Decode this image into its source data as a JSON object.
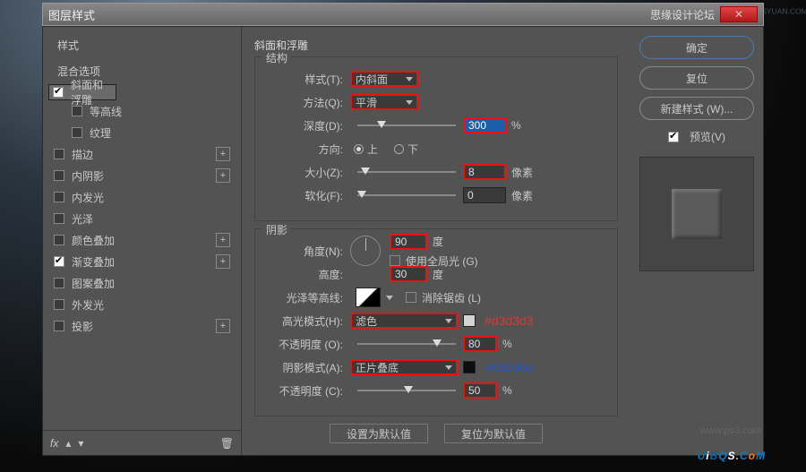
{
  "window": {
    "title": "图层样式",
    "brand": "思缘设计论坛",
    "watermark_url": "WWW.MISSYUAN.COM",
    "watermark2": "UiBQS.CoM",
    "ps3": "www.ps3.com"
  },
  "styles": {
    "header": "样式",
    "blending": "混合选项",
    "items": [
      {
        "label": "斜面和浮雕",
        "checked": true,
        "selected": true
      },
      {
        "label": "等高线",
        "checked": false,
        "indent": true
      },
      {
        "label": "纹理",
        "checked": false,
        "indent": true
      },
      {
        "label": "描边",
        "checked": false,
        "plus": true
      },
      {
        "label": "内阴影",
        "checked": false,
        "plus": true
      },
      {
        "label": "内发光",
        "checked": false
      },
      {
        "label": "光泽",
        "checked": false
      },
      {
        "label": "颜色叠加",
        "checked": false,
        "plus": true
      },
      {
        "label": "渐变叠加",
        "checked": true,
        "plus": true
      },
      {
        "label": "图案叠加",
        "checked": false
      },
      {
        "label": "外发光",
        "checked": false
      },
      {
        "label": "投影",
        "checked": false,
        "plus": true
      }
    ],
    "fx": "fx"
  },
  "bevel": {
    "title": "斜面和浮雕",
    "structure_legend": "结构",
    "style_label": "样式(T):",
    "style_value": "内斜面",
    "technique_label": "方法(Q):",
    "technique_value": "平滑",
    "depth_label": "深度(D):",
    "depth_value": "300",
    "depth_unit": "%",
    "direction_label": "方向:",
    "up": "上",
    "down": "下",
    "size_label": "大小(Z):",
    "size_value": "8",
    "size_unit": "像素",
    "soften_label": "软化(F):",
    "soften_value": "0",
    "soften_unit": "像素"
  },
  "shading": {
    "legend": "阴影",
    "angle_label": "角度(N):",
    "angle_value": "90",
    "angle_unit": "度",
    "global_label": "使用全局光 (G)",
    "altitude_label": "高度:",
    "altitude_value": "30",
    "altitude_unit": "度",
    "gloss_label": "光泽等高线:",
    "antialias_label": "消除锯齿 (L)",
    "highlight_mode_label": "高光模式(H):",
    "highlight_mode_value": "滤色",
    "highlight_color_note": "#d3d3d3",
    "highlight_opacity_label": "不透明度 (O):",
    "highlight_opacity_value": "80",
    "opacity_unit": "%",
    "shadow_mode_label": "阴影模式(A):",
    "shadow_mode_value": "正片叠底",
    "shadow_color_note": "#0d0d0d",
    "shadow_opacity_label": "不透明度 (C):",
    "shadow_opacity_value": "50"
  },
  "footer_buttons": {
    "default": "设置为默认值",
    "reset": "复位为默认值"
  },
  "rightpanel": {
    "ok": "确定",
    "cancel": "复位",
    "newstyle": "新建样式 (W)...",
    "preview": "预览(V)"
  },
  "colors": {
    "highlight_swatch": "#d3d3d3",
    "shadow_swatch": "#0d0d0d"
  }
}
